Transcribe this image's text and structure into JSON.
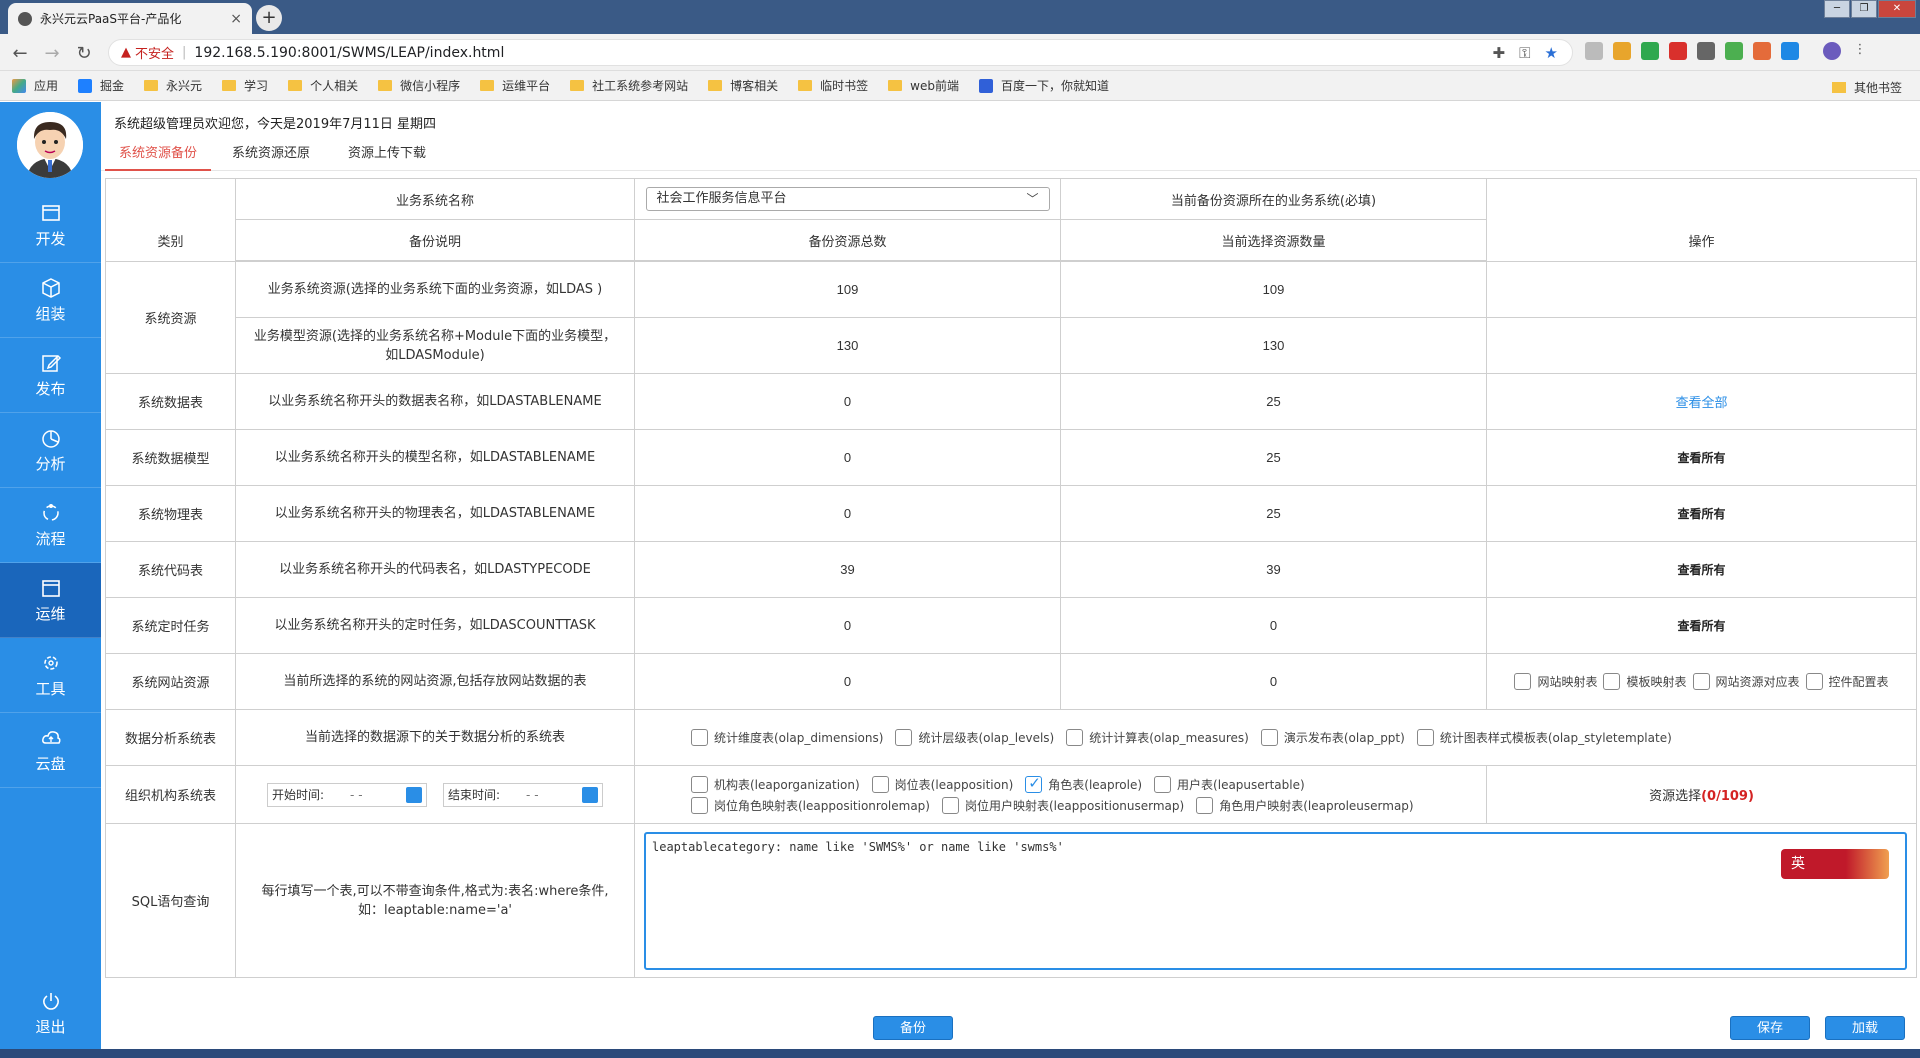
{
  "browser": {
    "tab_title": "永兴元云PaaS平台-产品化",
    "tab_close": "×",
    "new_tab": "+",
    "insecure_label": "不安全",
    "url": "192.168.5.190:8001/SWMS/LEAP/index.html",
    "bookmarks": [
      "应用",
      "掘金",
      "永兴元",
      "学习",
      "个人相关",
      "微信小程序",
      "运维平台",
      "社工系统参考网站",
      "博客相关",
      "临时书签",
      "web前端",
      "百度一下，你就知道"
    ],
    "other_bookmarks": "其他书签"
  },
  "sidebar": {
    "items": [
      {
        "label": "开发"
      },
      {
        "label": "组装"
      },
      {
        "label": "发布"
      },
      {
        "label": "分析"
      },
      {
        "label": "流程"
      },
      {
        "label": "运维"
      },
      {
        "label": "工具"
      },
      {
        "label": "云盘"
      }
    ],
    "active_index": 5,
    "logout": "退出"
  },
  "header": {
    "welcome": "系统超级管理员欢迎您，今天是2019年7月11日 星期四"
  },
  "subtabs": [
    "系统资源备份",
    "系统资源还原",
    "资源上传下载"
  ],
  "form": {
    "biz_system_label": "业务系统名称",
    "biz_system_value": "社会工作服务信息平台",
    "biz_system_hint": "当前备份资源所在的业务系统(必填)",
    "headers": [
      "类别",
      "备份说明",
      "备份资源总数",
      "当前选择资源数量",
      "操作"
    ],
    "system_resources": {
      "category": "系统资源",
      "rows": [
        {
          "desc": "业务系统资源(选择的业务系统下面的业务资源，如LDAS )",
          "total": "109",
          "selected": "109"
        },
        {
          "desc": "业务模型资源(选择的业务系统名称+Module下面的业务模型，如LDASModule)",
          "total": "130",
          "selected": "130"
        }
      ]
    },
    "rows": [
      {
        "category": "系统数据表",
        "desc": "以业务系统名称开头的数据表名称，如LDASTABLENAME",
        "total": "0",
        "selected": "25",
        "action": "查看全部"
      },
      {
        "category": "系统数据模型",
        "desc": "以业务系统名称开头的模型名称，如LDASTABLENAME",
        "total": "0",
        "selected": "25",
        "action": "查看所有"
      },
      {
        "category": "系统物理表",
        "desc": "以业务系统名称开头的物理表名，如LDASTABLENAME",
        "total": "0",
        "selected": "25",
        "action": "查看所有"
      },
      {
        "category": "系统代码表",
        "desc": "以业务系统名称开头的代码表名，如LDASTYPECODE",
        "total": "39",
        "selected": "39",
        "action": "查看所有"
      },
      {
        "category": "系统定时任务",
        "desc": "以业务系统名称开头的定时任务，如LDASCOUNTTASK",
        "total": "0",
        "selected": "0",
        "action": "查看所有"
      }
    ],
    "website": {
      "category": "系统网站资源",
      "desc": "当前所选择的系统的网站资源,包括存放网站数据的表",
      "total": "0",
      "selected": "0",
      "options": [
        "网站映射表",
        "模板映射表",
        "网站资源对应表",
        "控件配置表"
      ]
    },
    "analysis": {
      "category": "数据分析系统表",
      "desc": "当前选择的数据源下的关于数据分析的系统表",
      "options": [
        "统计维度表(olap_dimensions)",
        "统计层级表(olap_levels)",
        "统计计算表(olap_measures)",
        "演示发布表(olap_ppt)",
        "统计图表样式模板表(olap_styletemplate)"
      ]
    },
    "org": {
      "category": "组织机构系统表",
      "start_label": "开始时间:",
      "end_label": "结束时间:",
      "date_placeholder": "-    -",
      "options_line1": [
        {
          "label": "机构表(leaporganization)",
          "checked": false
        },
        {
          "label": "岗位表(leapposition)",
          "checked": false
        },
        {
          "label": "角色表(leaprole)",
          "checked": true
        },
        {
          "label": "用户表(leapusertable)",
          "checked": false
        }
      ],
      "options_line2": [
        {
          "label": "岗位角色映射表(leappositionrolemap)",
          "checked": false
        },
        {
          "label": "岗位用户映射表(leappositionusermap)",
          "checked": false
        },
        {
          "label": "角色用户映射表(leaproleusermap)",
          "checked": false
        }
      ],
      "resource_label": "资源选择",
      "resource_count": "(0/109)"
    },
    "sql": {
      "category": "SQL语句查询",
      "desc": "每行填写一个表,可以不带查询条件,格式为:表名:where条件,如：leaptable:name='a'",
      "value": "leaptablecategory: name like 'SWMS%' or name like 'swms%'",
      "ime_label": "英"
    }
  },
  "buttons": {
    "backup": "备份",
    "save": "保存",
    "load": "加载"
  },
  "colors": {
    "sidebar": "#2a8ee6",
    "sidebar_active": "#1a66bb",
    "accent_red": "#e0524a",
    "selected_number": "#2a6e1c"
  }
}
